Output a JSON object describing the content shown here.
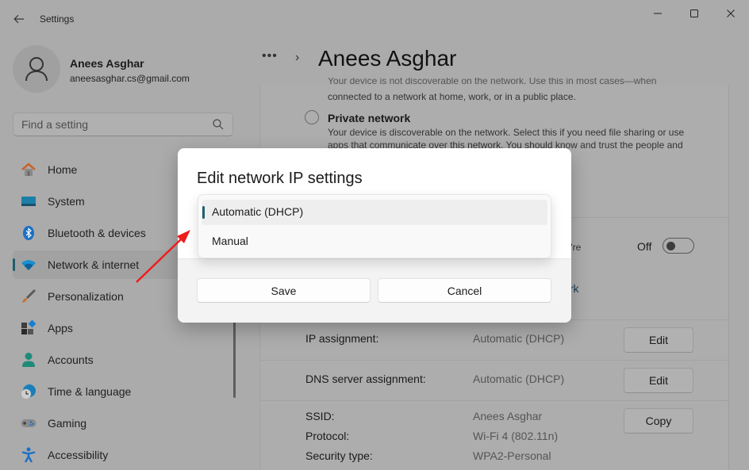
{
  "window": {
    "app_title": "Settings",
    "controls": {
      "minimize": "minimize-icon",
      "maximize": "maximize-icon",
      "close": "close-icon"
    }
  },
  "profile": {
    "name": "Anees Asghar",
    "email": "aneesasghar.cs@gmail.com"
  },
  "search": {
    "placeholder": "Find a setting",
    "value": ""
  },
  "sidebar": {
    "items": [
      {
        "label": "Home",
        "icon": "home-icon",
        "active": false
      },
      {
        "label": "System",
        "icon": "system-icon",
        "active": false
      },
      {
        "label": "Bluetooth & devices",
        "icon": "bluetooth-icon",
        "active": false
      },
      {
        "label": "Network & internet",
        "icon": "wifi-icon",
        "active": true
      },
      {
        "label": "Personalization",
        "icon": "brush-icon",
        "active": false
      },
      {
        "label": "Apps",
        "icon": "apps-icon",
        "active": false
      },
      {
        "label": "Accounts",
        "icon": "account-icon",
        "active": false
      },
      {
        "label": "Time & language",
        "icon": "globe-clock-icon",
        "active": false
      },
      {
        "label": "Gaming",
        "icon": "gamepad-icon",
        "active": false
      },
      {
        "label": "Accessibility",
        "icon": "accessibility-icon",
        "active": false
      }
    ]
  },
  "breadcrumb": {
    "overflow": "•••",
    "separator": "›",
    "title": "Anees Asghar"
  },
  "content": {
    "public_desc_line1": "Your device is not discoverable on the network. Use this in most cases—when",
    "public_desc_line2": "connected to a network at home, work, or in a public place.",
    "private_title": "Private network",
    "private_desc_line1": "Your device is discoverable on the network. Select this if you need file sharing or use",
    "private_desc_line2": "apps that communicate over this network. You should know and trust the people and",
    "metered_partial": "you're",
    "toggle_label": "Off",
    "toggle_on": false,
    "link_partial": "work",
    "properties": [
      {
        "label": "IP assignment:",
        "value": "Automatic (DHCP)",
        "button": "Edit"
      },
      {
        "label": "DNS server assignment:",
        "value": "Automatic (DHCP)",
        "button": "Edit"
      }
    ],
    "wifi_info": {
      "button": "Copy",
      "rows": [
        {
          "label": "SSID:",
          "value": "Anees Asghar"
        },
        {
          "label": "Protocol:",
          "value": "Wi-Fi 4 (802.11n)"
        },
        {
          "label": "Security type:",
          "value": "WPA2-Personal"
        }
      ]
    }
  },
  "dialog": {
    "title": "Edit network IP settings",
    "options": [
      {
        "label": "Automatic (DHCP)",
        "selected": true
      },
      {
        "label": "Manual",
        "selected": false
      }
    ],
    "save_label": "Save",
    "cancel_label": "Cancel"
  },
  "annotation": {
    "arrow_color": "#ee1c1c"
  },
  "colors": {
    "accent": "#1f5f6b",
    "overlay_bg": "#ababab",
    "link": "#163f4f"
  }
}
